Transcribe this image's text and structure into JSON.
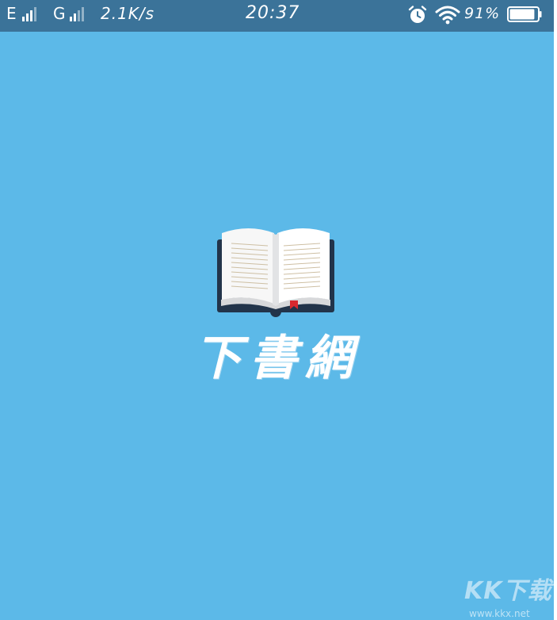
{
  "status_bar": {
    "sim1_network": "E",
    "sim2_network": "G",
    "speed": "2.1K/s",
    "time": "20:37",
    "battery_percent": "91%",
    "battery_level": 0.91,
    "icons": [
      "signal-icon",
      "alarm-icon",
      "wifi-icon",
      "battery-icon"
    ]
  },
  "splash": {
    "logo_icon": "open-book-icon",
    "app_name": "下書網"
  },
  "watermark": {
    "logo_text": "KK下载",
    "url": "www.kkx.net"
  },
  "colors": {
    "background": "#5cb9e8",
    "status_bar": "#3b7399",
    "book_cover": "#22344a",
    "bookmark": "#d8292f"
  }
}
